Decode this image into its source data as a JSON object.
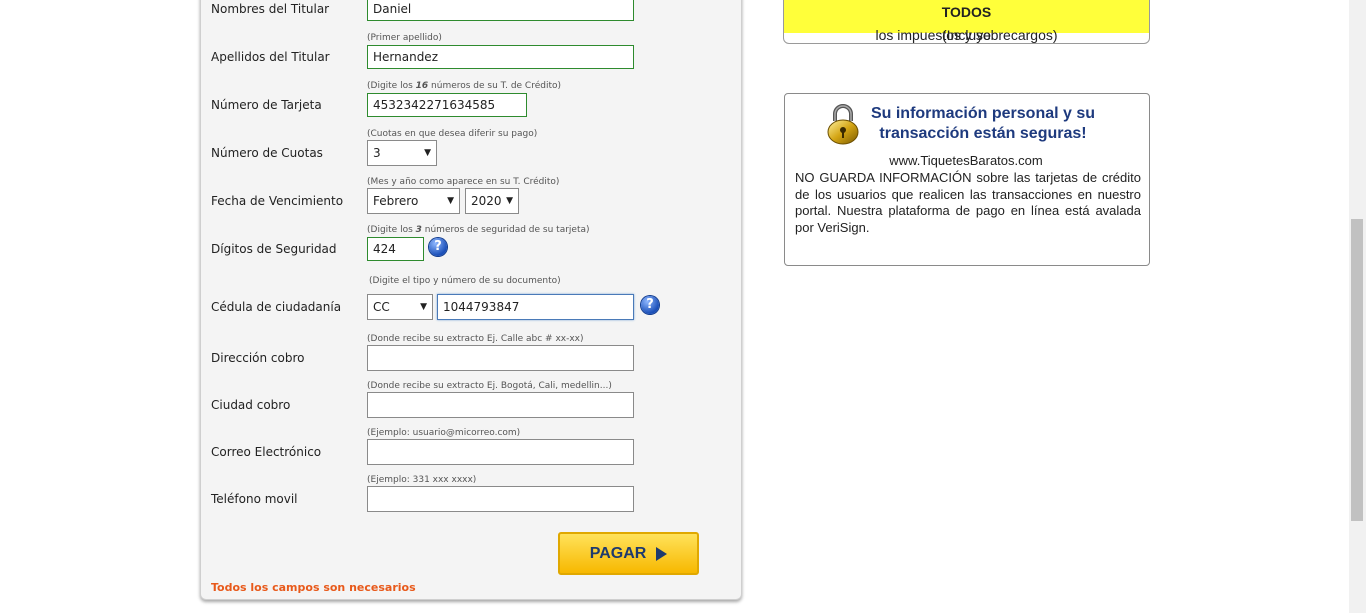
{
  "form": {
    "fields": [
      {
        "label": "Nombres del Titular",
        "hint": "",
        "value": "Daniel",
        "placeholder": ""
      },
      {
        "label": "Apellidos del Titular",
        "hint": "(Primer apellido)",
        "value": "Hernandez",
        "placeholder": ""
      },
      {
        "label": "Número de Tarjeta",
        "hint_pre": "(Digite los ",
        "hint_bold": "16",
        "hint_post": " números de su T. de Crédito)",
        "value": "4532342271634585"
      },
      {
        "label": "Número de Cuotas",
        "hint": "(Cuotas en que desea diferir su pago)",
        "value": "3"
      },
      {
        "label": "Fecha de Vencimiento",
        "hint": "(Mes y año como aparece en su T. Crédito)",
        "month": "Febrero",
        "year": "2020"
      },
      {
        "label": "Dígitos de Seguridad",
        "hint_pre": "(Digite los ",
        "hint_bold": "3",
        "hint_post": " números de seguridad de su tarjeta)",
        "value": "424"
      },
      {
        "label": "Cédula de ciudadanía",
        "hint": "(Digite el tipo y número de su documento)",
        "doc_type": "CC",
        "value": "1044793847"
      },
      {
        "label": "Dirección cobro",
        "hint": "(Donde recibe su extracto Ej. Calle abc # xx-xx)",
        "value": ""
      },
      {
        "label": "Ciudad cobro",
        "hint": "(Donde recibe su extracto Ej. Bogotá, Cali, medellin...)",
        "value": ""
      },
      {
        "label": "Correo Electrónico",
        "hint": "(Ejemplo: usuario@micorreo.com)",
        "value": ""
      },
      {
        "label": "Teléfono movil",
        "hint": "(Ejemplo: 331 xxx xxxx)",
        "value": ""
      }
    ],
    "pay_label": "PAGAR",
    "required_note": "Todos los campos son necesarios",
    "help_glyph": "?"
  },
  "price_box": {
    "pre": "(Incluye ",
    "bold": "TODOS",
    "post": " los impuestos y sobrecargos)"
  },
  "security": {
    "title": "Su información personal y su transacción están seguras!",
    "site": "www.TiquetesBaratos.com",
    "body": "NO GUARDA INFORMACIÓN sobre las tarjetas de crédito de los usuarios que realicen las transacciones en nuestro portal. Nuestra plataforma de pago en línea está avalada por VeriSign."
  },
  "icons": {
    "help": "help-circle-icon",
    "lock": "padlock-icon",
    "pay_arrow": "play-arrow-icon",
    "dropdown": "triangle-down-icon"
  },
  "colors": {
    "accent_yellow": "#ffe25a",
    "pay_text": "#1e3a6e",
    "required": "#e8591a",
    "valid_border": "#2e8b2e"
  }
}
